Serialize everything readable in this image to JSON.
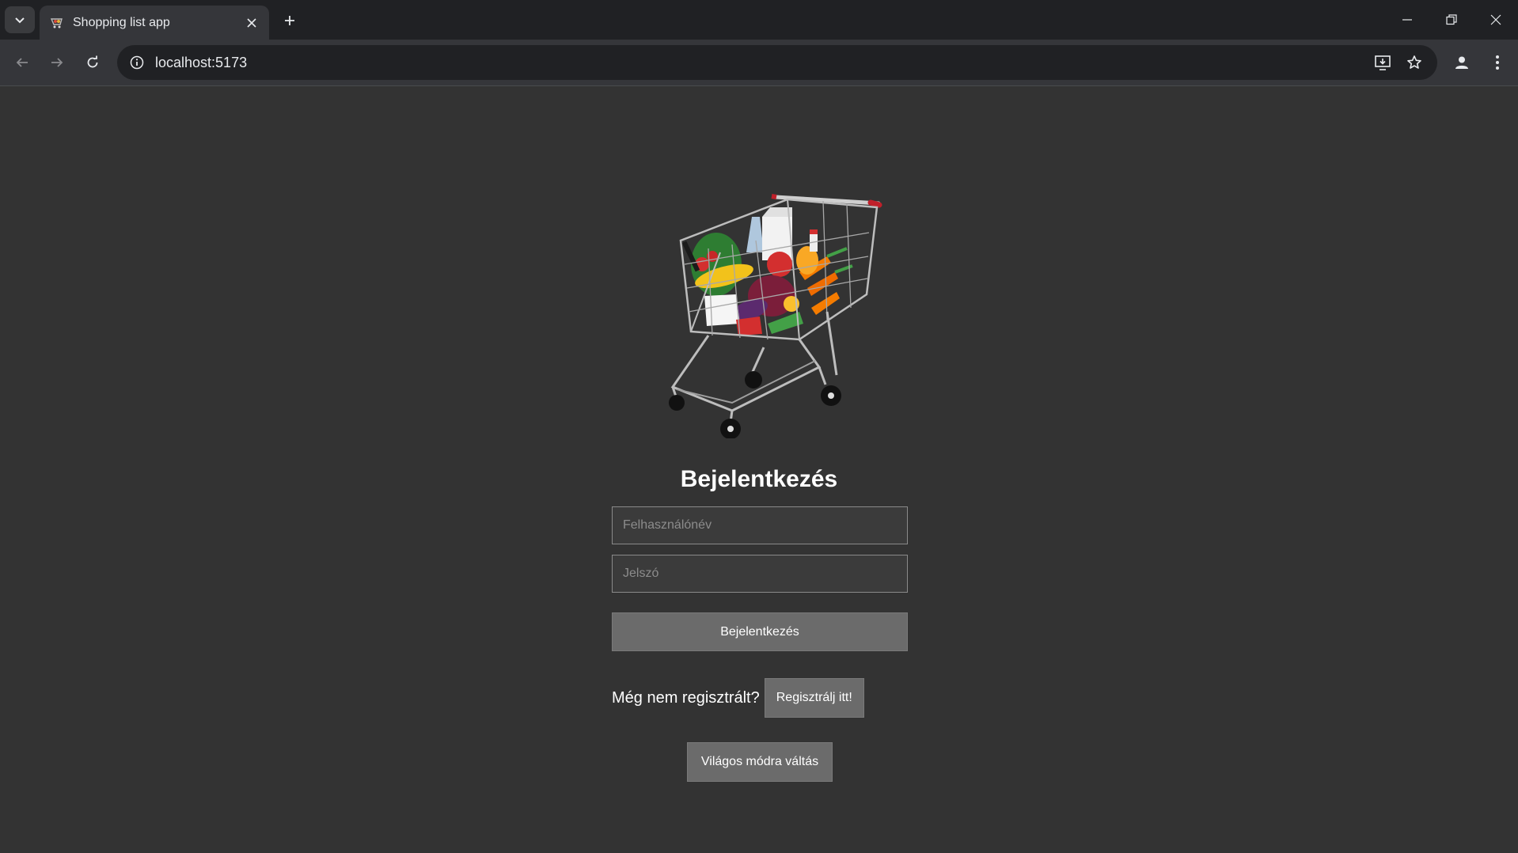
{
  "browser": {
    "tab_title": "Shopping list app",
    "url": "localhost:5173"
  },
  "login": {
    "title": "Bejelentkezés",
    "username_placeholder": "Felhasználónév",
    "password_placeholder": "Jelszó",
    "submit_label": "Bejelentkezés",
    "register_prompt": "Még nem regisztrált?",
    "register_label": "Regisztrálj itt!",
    "theme_toggle_label": "Világos módra váltás"
  },
  "colors": {
    "page_background": "#333333",
    "button_background": "#6b6b6b",
    "text": "#ffffff"
  }
}
